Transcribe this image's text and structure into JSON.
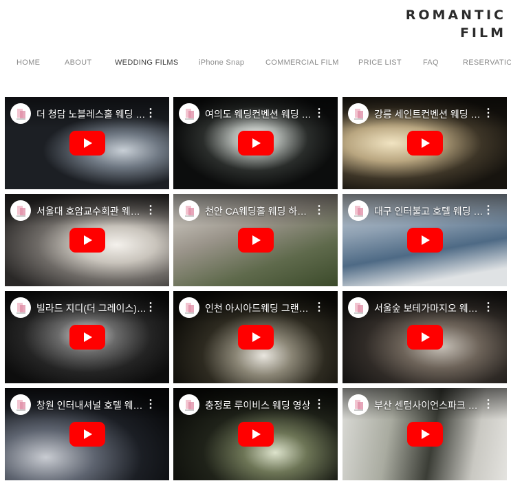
{
  "brand": {
    "line1": "ROMANTIC",
    "line2": "FILM"
  },
  "nav": {
    "items": [
      {
        "label": "HOME"
      },
      {
        "label": "ABOUT"
      },
      {
        "label": "WEDDING FILMS",
        "active": true
      },
      {
        "label": "iPhone Snap"
      },
      {
        "label": "COMMERCIAL FILM"
      },
      {
        "label": "PRICE LIST"
      },
      {
        "label": "FAQ"
      },
      {
        "label": "RESERVATION"
      }
    ]
  },
  "colors": {
    "youtube_red": "#ff0000",
    "nav_active": "#3a3a3a",
    "nav_inactive": "#8a8a8a"
  },
  "icons": {
    "channel": "channel-avatar-icon",
    "menu": "more-vert-icon",
    "play": "youtube-play-icon"
  },
  "videos": [
    {
      "title": "더 청담 노블레스홀 웨딩 영상",
      "menu": "⋮"
    },
    {
      "title": "여의도 웨딩컨벤션 웨딩 영상",
      "menu": "⋮"
    },
    {
      "title": "강릉 세인트컨벤션 웨딩 영상",
      "menu": "⋮"
    },
    {
      "title": "서울대 호암교수회관 웨딩 영상",
      "menu": "⋮"
    },
    {
      "title": "천안 CA웨딩홀 웨딩 하이라이트",
      "menu": "⋮"
    },
    {
      "title": "대구 인터불고 호텔 웨딩 영상",
      "menu": "⋮"
    },
    {
      "title": "빌라드 지디(더 그레이스) 웨딩",
      "menu": "⋮"
    },
    {
      "title": "인천 아시아드웨딩 그랜드홀",
      "menu": "⋮"
    },
    {
      "title": "서울숲 보테가마지오 웨딩 영상",
      "menu": "⋮"
    },
    {
      "title": "창원 인터내셔널 호텔 웨딩 영상",
      "menu": "⋮"
    },
    {
      "title": "충정로 루이비스 웨딩 영상",
      "menu": "⋮"
    },
    {
      "title": "부산 센텀사이언스파크 웨딩 영상",
      "menu": "⋮"
    }
  ]
}
